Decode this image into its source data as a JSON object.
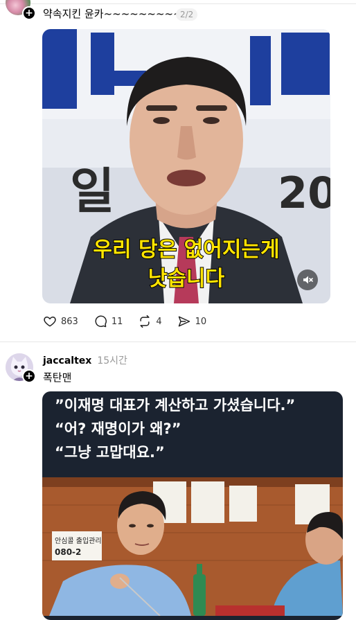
{
  "post1": {
    "text": "약속지킨 윤카~~~~~~~~~",
    "pager": "2/2",
    "subtitle_line1": "우리 당은 없어지는게",
    "subtitle_line2": "낫습니다",
    "backdrop_text": "일",
    "backdrop_text2": "20",
    "counts": {
      "likes": "863",
      "comments": "11",
      "reposts": "4",
      "shares": "10"
    }
  },
  "post2": {
    "username": "jaccaltex",
    "time": "15시간",
    "text": "폭탄맨",
    "quotes": [
      "”이재명 대표가 계산하고 가셨습니다.”",
      "“어? 재명이가 왜?”",
      "“그냥 고맙대요.”"
    ],
    "sign_text": "안심콜 출입관리",
    "sign_phone": "080-2"
  },
  "icons": {
    "follow": "plus-icon",
    "like": "heart-icon",
    "comment": "comment-icon",
    "repost": "repost-icon",
    "share": "send-icon",
    "mute": "muted-speaker-icon"
  }
}
